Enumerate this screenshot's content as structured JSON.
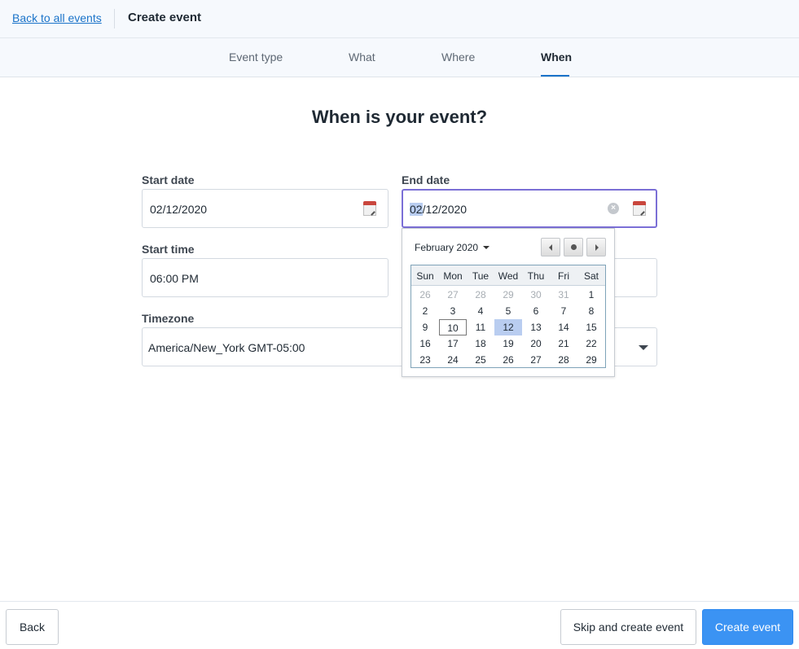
{
  "topbar": {
    "back_link": "Back to all events",
    "title": "Create event"
  },
  "steps": [
    {
      "label": "Event type"
    },
    {
      "label": "What"
    },
    {
      "label": "Where"
    },
    {
      "label": "When",
      "active": true
    }
  ],
  "heading": "When is your event?",
  "form": {
    "start_date": {
      "label": "Start date",
      "value": "02/12/2020"
    },
    "end_date": {
      "label": "End date",
      "segments": [
        "02",
        "/12/2020"
      ]
    },
    "start_time": {
      "label": "Start time",
      "value": "06:00 PM"
    },
    "timezone": {
      "label": "Timezone",
      "value": "America/New_York GMT-05:00"
    }
  },
  "datepicker": {
    "month_label": "February 2020",
    "weekdays": [
      "Sun",
      "Mon",
      "Tue",
      "Wed",
      "Thu",
      "Fri",
      "Sat"
    ],
    "weeks": [
      [
        "26",
        "27",
        "28",
        "29",
        "30",
        "31",
        "1"
      ],
      [
        "2",
        "3",
        "4",
        "5",
        "6",
        "7",
        "8"
      ],
      [
        "9",
        "10",
        "11",
        "12",
        "13",
        "14",
        "15"
      ],
      [
        "16",
        "17",
        "18",
        "19",
        "20",
        "21",
        "22"
      ],
      [
        "23",
        "24",
        "25",
        "26",
        "27",
        "28",
        "29"
      ]
    ],
    "other_month_days": 6,
    "today": "10",
    "selected": "12"
  },
  "footer": {
    "back": "Back",
    "skip": "Skip and create event",
    "create": "Create event"
  },
  "colors": {
    "accent": "#3b93f3",
    "link": "#1a73c9",
    "focus_border": "#7b6fd6",
    "selection": "#b9cdf0"
  },
  "icons": [
    "calendar-icon",
    "clear-icon",
    "caret-down-icon",
    "prev-month-icon",
    "today-dot-icon",
    "next-month-icon"
  ]
}
